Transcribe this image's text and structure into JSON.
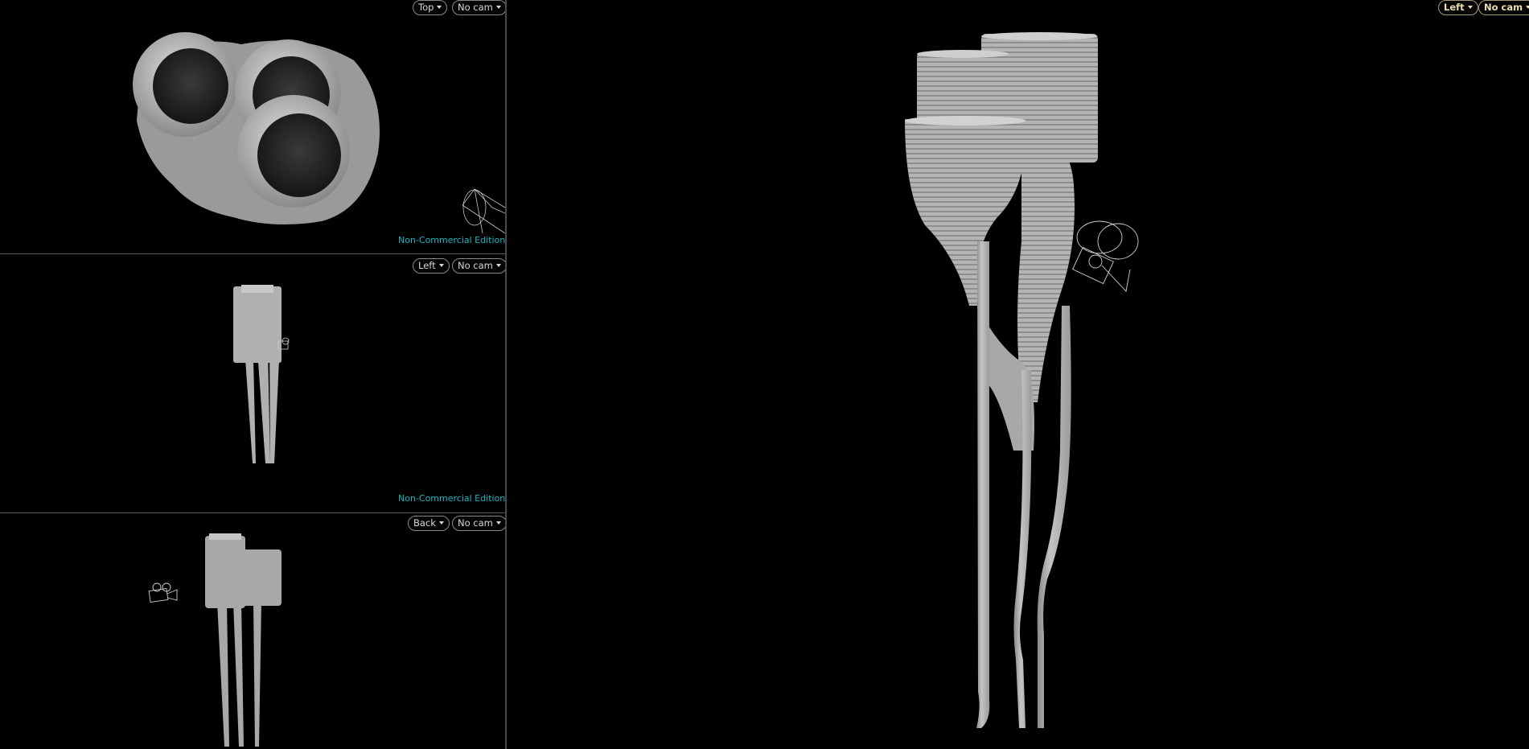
{
  "colors": {
    "background": "#000000",
    "watermark": "#19b7c3",
    "model_fill": "#b8b8b8",
    "model_dark": "#8c8c8c",
    "separator": "#5a5a5a"
  },
  "viewports": {
    "top": {
      "view_label": "Top",
      "camera_label": "No cam",
      "watermark": "Non-Commercial Edition"
    },
    "left_small": {
      "view_label": "Left",
      "camera_label": "No cam",
      "watermark": "Non-Commercial Edition"
    },
    "back": {
      "view_label": "Back",
      "camera_label": "No cam"
    },
    "main": {
      "view_label": "Left",
      "camera_label": "No cam"
    }
  },
  "icons": {
    "dropdown": "chevron-down-icon",
    "camera": "camera-gizmo-icon",
    "light": "light-gizmo-icon"
  }
}
